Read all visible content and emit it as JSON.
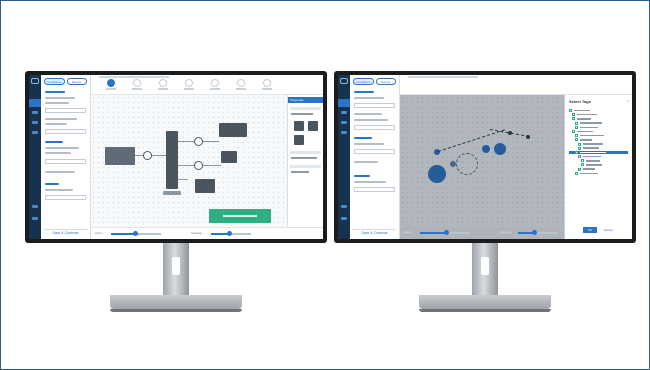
{
  "left_screen": {
    "side_tabs": [
      "Conditions",
      "Events"
    ],
    "side_footer": "Save & Continue",
    "panel_header": "Properties",
    "toast": "",
    "bottom_labels": [
      "Zoom",
      "Spacing"
    ]
  },
  "right_screen": {
    "side_tabs": [
      "Conditions",
      "Events"
    ],
    "side_footer": "Save & Continue",
    "dialog_title": "Select Tags",
    "dialog_close": "×",
    "ok_label": "OK",
    "cancel_label": "Cancel",
    "bottom_labels": [
      "Zoom",
      "Spacing"
    ]
  },
  "colors": {
    "accent": "#2a73c7",
    "nav": "#17324f",
    "success": "#2fae84",
    "bezel": "#1b1c1e"
  }
}
